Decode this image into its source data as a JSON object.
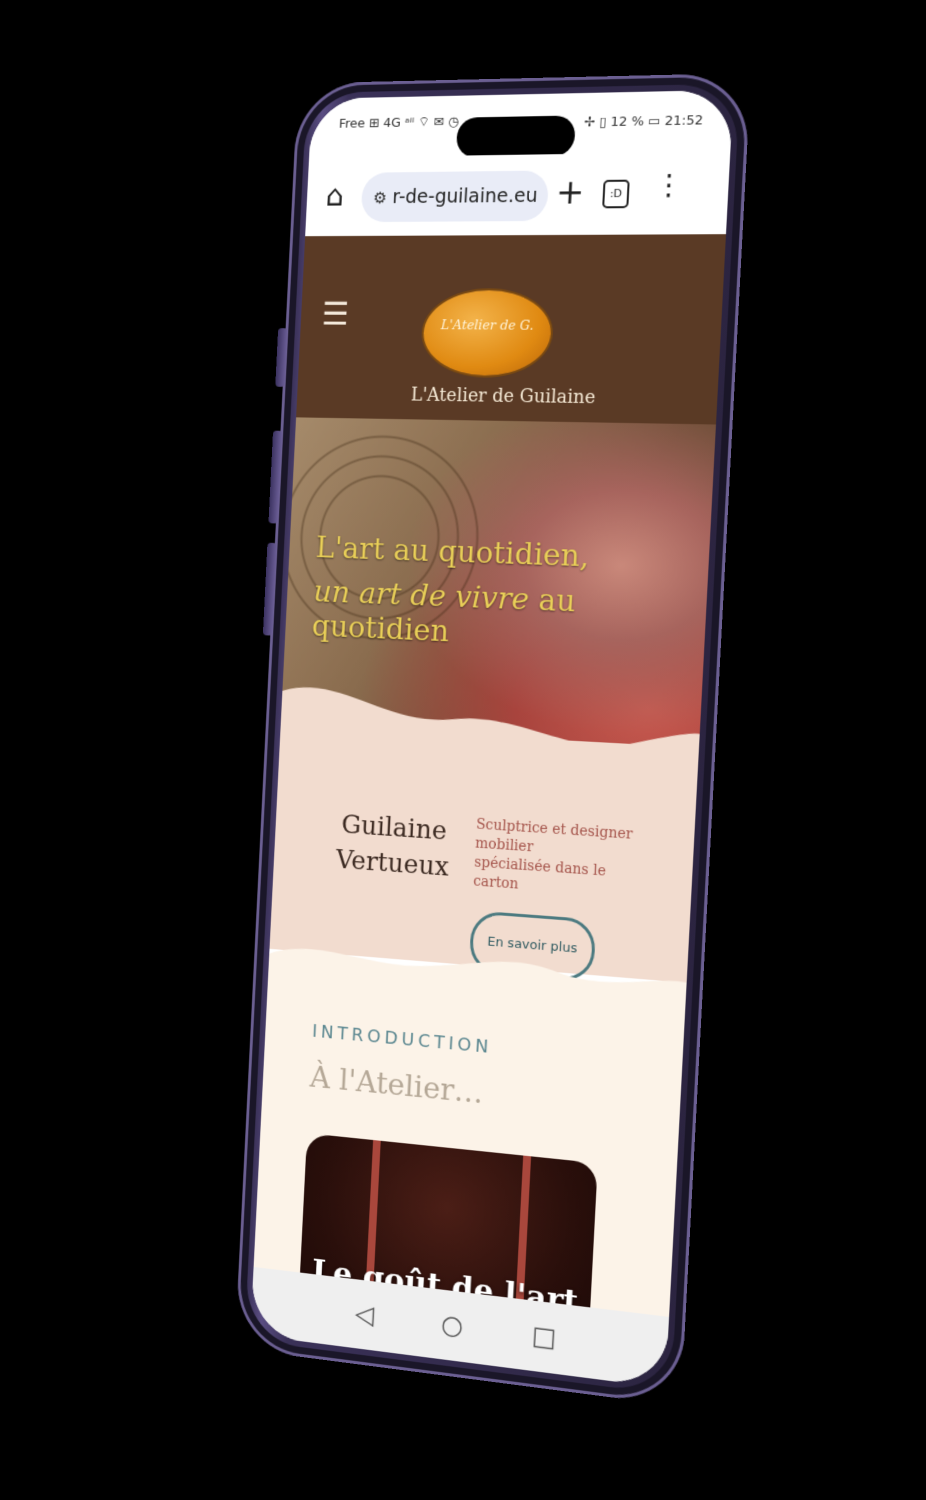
{
  "status_bar": {
    "left_text": "Free ⊞ 4G ᵃⁱˡ ⌔ ✉ ◷",
    "right_text": "✢ ▯ 12 % ▭ 21:52"
  },
  "browser": {
    "url": "r-de-guilaine.eu",
    "tabs_count": ":D"
  },
  "site": {
    "logo_text": "L'Atelier de G.",
    "logo_initial": "G.",
    "name": "L'Atelier de Guilaine"
  },
  "hero": {
    "line1": "L'art au quotidien,",
    "line2_em": "un art de vivre",
    "line2_rest": " au quotidien"
  },
  "profile": {
    "first_name": "Guilaine",
    "last_name": "Vertueux",
    "tag_line1": "Sculptrice et designer",
    "tag_line2": "mobilier",
    "tag_line3": "spécialisée dans le carton",
    "cta_label": "En savoir plus"
  },
  "intro": {
    "eyebrow": "INTRODUCTION",
    "title": "À l'Atelier…",
    "card_text": "Le goût de l'art"
  },
  "colors": {
    "header_bg": "#5a3a25",
    "hero_text": "#e9cf58",
    "band_bg": "#f2dccf",
    "cream_bg": "#fcf3e8",
    "accent_teal": "#4c7a80"
  }
}
